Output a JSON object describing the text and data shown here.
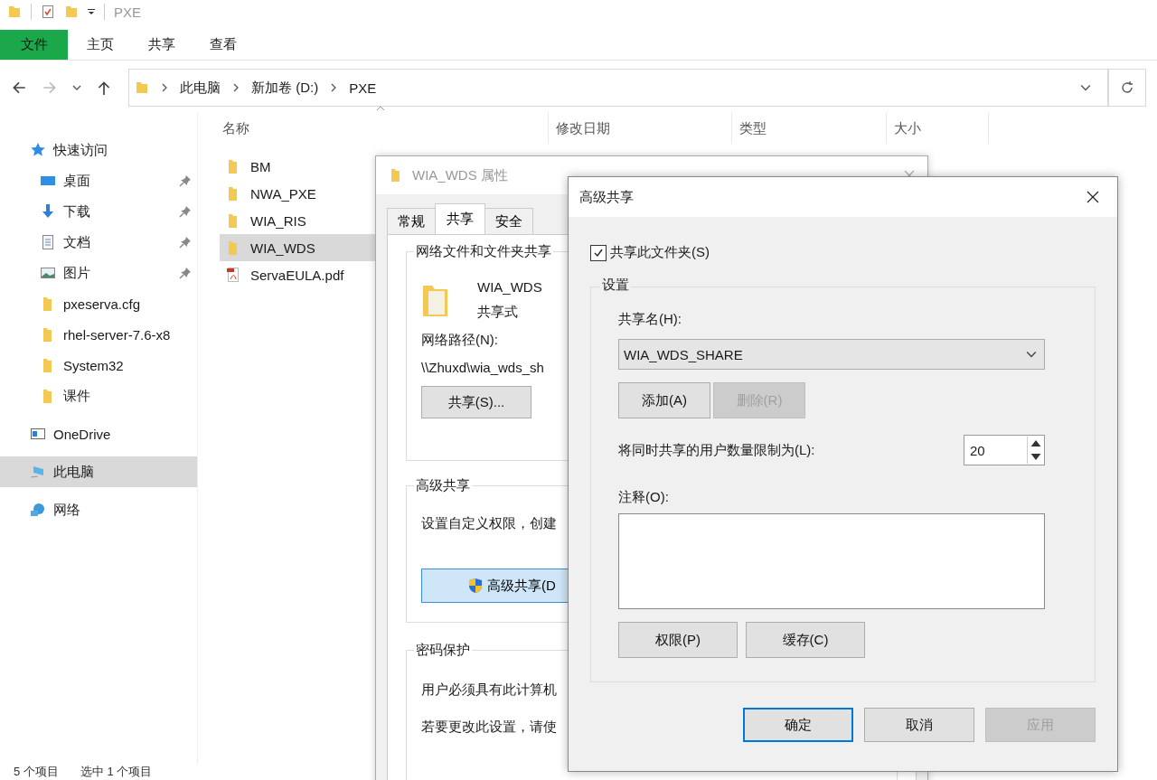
{
  "explorer": {
    "title": "PXE",
    "ribbon_tabs": [
      {
        "label": "文件",
        "selected": true
      },
      {
        "label": "主页",
        "selected": false
      },
      {
        "label": "共享",
        "selected": false
      },
      {
        "label": "查看",
        "selected": false
      }
    ],
    "breadcrumb": [
      "此电脑",
      "新加卷 (D:)",
      "PXE"
    ],
    "nav": [
      {
        "label": "快速访问",
        "kind": "star",
        "selected": false,
        "children": [
          {
            "label": "桌面",
            "kind": "desktop",
            "pinned": true,
            "selected": false
          },
          {
            "label": "下载",
            "kind": "download",
            "pinned": true,
            "selected": false
          },
          {
            "label": "文档",
            "kind": "docs",
            "pinned": true,
            "selected": false
          },
          {
            "label": "图片",
            "kind": "pictures",
            "pinned": true,
            "selected": false
          },
          {
            "label": "pxeserva.cfg",
            "kind": "folder",
            "pinned": false,
            "selected": false
          },
          {
            "label": "rhel-server-7.6-x8",
            "kind": "folder",
            "pinned": false,
            "selected": false
          },
          {
            "label": "System32",
            "kind": "folder",
            "pinned": false,
            "selected": false
          },
          {
            "label": "课件",
            "kind": "folder",
            "pinned": false,
            "selected": false
          }
        ]
      },
      {
        "label": "OneDrive",
        "kind": "onedrive",
        "selected": false
      },
      {
        "label": "此电脑",
        "kind": "pc",
        "selected": true
      },
      {
        "label": "网络",
        "kind": "network",
        "selected": false
      }
    ],
    "columns": [
      "名称",
      "修改日期",
      "类型",
      "大小"
    ],
    "files": [
      {
        "name": "BM",
        "kind": "folder",
        "selected": false
      },
      {
        "name": "NWA_PXE",
        "kind": "folder",
        "selected": false
      },
      {
        "name": "WIA_RIS",
        "kind": "folder",
        "selected": false
      },
      {
        "name": "WIA_WDS",
        "kind": "folder",
        "selected": true
      },
      {
        "name": "ServaEULA.pdf",
        "kind": "pdf",
        "selected": false
      }
    ],
    "status_bar": [
      "5 个项目",
      "选中 1 个项目"
    ]
  },
  "properties_dialog": {
    "title": "WIA_WDS 属性",
    "tabs": [
      {
        "label": "常规",
        "selected": false
      },
      {
        "label": "共享",
        "selected": true
      },
      {
        "label": "安全",
        "selected": false
      }
    ],
    "network_group": {
      "title": "网络文件和文件夹共享",
      "folder_name": "WIA_WDS",
      "folder_status": "共享式",
      "path_label": "网络路径(N):",
      "path": "\\\\Zhuxd\\wia_wds_sh",
      "button": "共享(S)..."
    },
    "advanced_group": {
      "title": "高级共享",
      "description": "设置自定义权限，创建",
      "button": "高级共享(D"
    },
    "password_group": {
      "title": "密码保护",
      "lines": [
        "用户必须具有此计算机",
        "若要更改此设置，请使"
      ]
    }
  },
  "advanced_dialog": {
    "title": "高级共享",
    "share_checkbox": {
      "label": "共享此文件夹(S)",
      "checked": true
    },
    "settings_group": {
      "title": "设置",
      "share_name_label": "共享名(H):",
      "share_name": "WIA_WDS_SHARE",
      "name_buttons": [
        {
          "label": "添加(A)",
          "disabled": false
        },
        {
          "label": "删除(R)",
          "disabled": true
        }
      ],
      "limit_label": "将同时共享的用户数量限制为(L):",
      "limit_value": "20",
      "comment_label": "注释(O):",
      "buttons": [
        {
          "label": "权限(P)",
          "disabled": false
        },
        {
          "label": "缓存(C)",
          "disabled": false
        }
      ]
    },
    "footer_buttons": [
      {
        "label": "确定",
        "default": true,
        "disabled": false
      },
      {
        "label": "取消",
        "default": false,
        "disabled": false
      },
      {
        "label": "应用",
        "default": false,
        "disabled": true
      }
    ]
  }
}
